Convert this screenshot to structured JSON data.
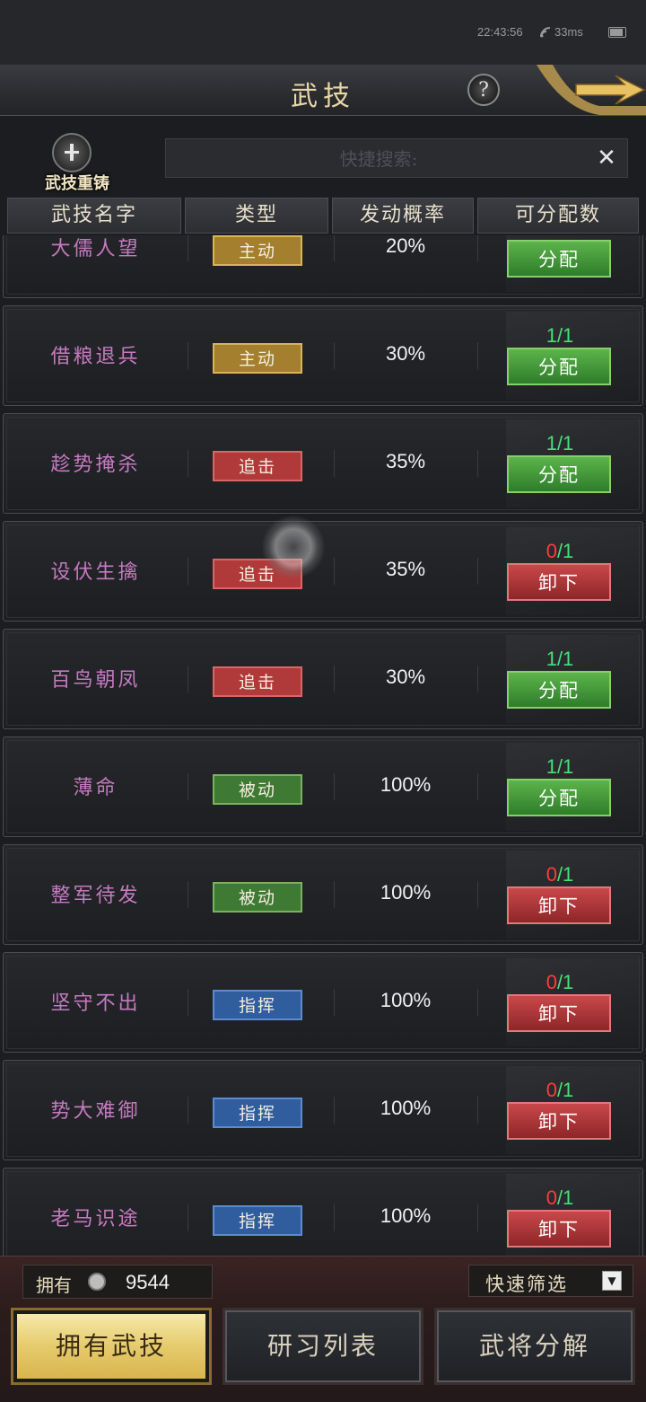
{
  "status_bar": {
    "time": "22:43:56",
    "ping": "33ms"
  },
  "header": {
    "title": "武技",
    "help_symbol": "?"
  },
  "recast": {
    "label": "武技重铸"
  },
  "search": {
    "placeholder": "快捷搜索:",
    "clear_symbol": "✕"
  },
  "columns": [
    "武技名字",
    "类型",
    "发动概率",
    "可分配数"
  ],
  "rows": [
    {
      "name": "大儒人望",
      "type": "主动",
      "type_kind": "active",
      "prob": "20%",
      "count_used": "",
      "count_total": "",
      "action": "分配",
      "action_kind": "assign"
    },
    {
      "name": "借粮退兵",
      "type": "主动",
      "type_kind": "active",
      "prob": "30%",
      "count_used": "1",
      "count_total": "/1",
      "action": "分配",
      "action_kind": "assign"
    },
    {
      "name": "趁势掩杀",
      "type": "追击",
      "type_kind": "chase",
      "prob": "35%",
      "count_used": "1",
      "count_total": "/1",
      "action": "分配",
      "action_kind": "assign"
    },
    {
      "name": "设伏生擒",
      "type": "追击",
      "type_kind": "chase",
      "prob": "35%",
      "count_used": "0",
      "count_total": "/1",
      "action": "卸下",
      "action_kind": "unload"
    },
    {
      "name": "百鸟朝凤",
      "type": "追击",
      "type_kind": "chase",
      "prob": "30%",
      "count_used": "1",
      "count_total": "/1",
      "action": "分配",
      "action_kind": "assign"
    },
    {
      "name": "薄命",
      "type": "被动",
      "type_kind": "passive",
      "prob": "100%",
      "count_used": "1",
      "count_total": "/1",
      "action": "分配",
      "action_kind": "assign"
    },
    {
      "name": "整军待发",
      "type": "被动",
      "type_kind": "passive",
      "prob": "100%",
      "count_used": "0",
      "count_total": "/1",
      "action": "卸下",
      "action_kind": "unload"
    },
    {
      "name": "坚守不出",
      "type": "指挥",
      "type_kind": "command",
      "prob": "100%",
      "count_used": "0",
      "count_total": "/1",
      "action": "卸下",
      "action_kind": "unload"
    },
    {
      "name": "势大难御",
      "type": "指挥",
      "type_kind": "command",
      "prob": "100%",
      "count_used": "0",
      "count_total": "/1",
      "action": "卸下",
      "action_kind": "unload"
    },
    {
      "name": "老马识途",
      "type": "指挥",
      "type_kind": "command",
      "prob": "100%",
      "count_used": "0",
      "count_total": "/1",
      "action": "卸下",
      "action_kind": "unload"
    }
  ],
  "owned": {
    "label": "拥有",
    "value": "9544"
  },
  "filter": {
    "label": "快速筛选"
  },
  "tabs": {
    "owned": "拥有武技",
    "research": "研习列表",
    "decompose": "武将分解"
  }
}
